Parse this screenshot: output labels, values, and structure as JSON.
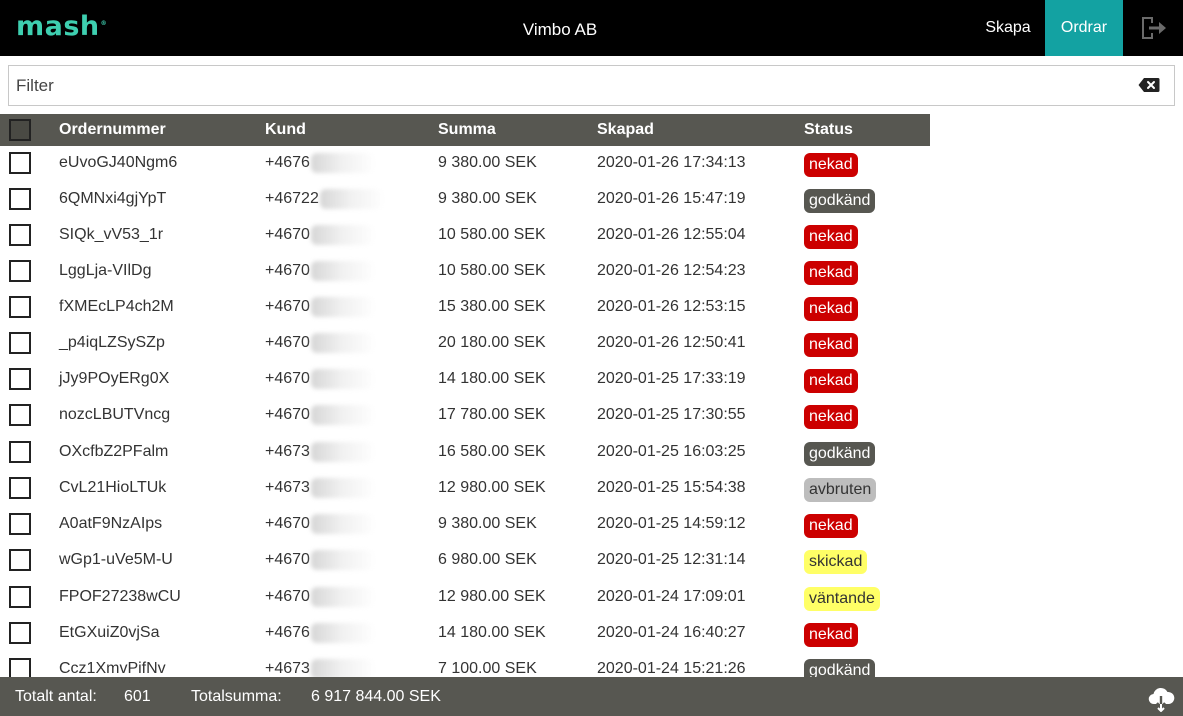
{
  "header": {
    "logo": "mash",
    "logo_mark": "®",
    "company": "Vimbo AB",
    "nav_create": "Skapa",
    "nav_orders": "Ordrar",
    "active_color": "#13a2a2"
  },
  "filter": {
    "placeholder": "Filter"
  },
  "table": {
    "columns": [
      "Ordernummer",
      "Kund",
      "Summa",
      "Skapad",
      "Status"
    ],
    "rows": [
      {
        "ordernummer": "eUvoGJ40Ngm6",
        "kund": "+4676",
        "summa": "9 380.00 SEK",
        "skapad": "2020-01-26 17:34:13",
        "status": "nekad"
      },
      {
        "ordernummer": "6QMNxi4gjYpT",
        "kund": "+46722",
        "summa": "9 380.00 SEK",
        "skapad": "2020-01-26 15:47:19",
        "status": "godkänd"
      },
      {
        "ordernummer": "SIQk_vV53_1r",
        "kund": "+4670",
        "summa": "10 580.00 SEK",
        "skapad": "2020-01-26 12:55:04",
        "status": "nekad"
      },
      {
        "ordernummer": "LggLja-VIlDg",
        "kund": "+4670",
        "summa": "10 580.00 SEK",
        "skapad": "2020-01-26 12:54:23",
        "status": "nekad"
      },
      {
        "ordernummer": "fXMEcLP4ch2M",
        "kund": "+4670",
        "summa": "15 380.00 SEK",
        "skapad": "2020-01-26 12:53:15",
        "status": "nekad"
      },
      {
        "ordernummer": "_p4iqLZSySZp",
        "kund": "+4670",
        "summa": "20 180.00 SEK",
        "skapad": "2020-01-26 12:50:41",
        "status": "nekad"
      },
      {
        "ordernummer": "jJy9POyERg0X",
        "kund": "+4670",
        "summa": "14 180.00 SEK",
        "skapad": "2020-01-25 17:33:19",
        "status": "nekad"
      },
      {
        "ordernummer": "nozcLBUTVncg",
        "kund": "+4670",
        "summa": "17 780.00 SEK",
        "skapad": "2020-01-25 17:30:55",
        "status": "nekad"
      },
      {
        "ordernummer": "OXcfbZ2PFalm",
        "kund": "+4673",
        "summa": "16 580.00 SEK",
        "skapad": "2020-01-25 16:03:25",
        "status": "godkänd"
      },
      {
        "ordernummer": "CvL21HioLTUk",
        "kund": "+4673",
        "summa": "12 980.00 SEK",
        "skapad": "2020-01-25 15:54:38",
        "status": "avbruten"
      },
      {
        "ordernummer": "A0atF9NzAIps",
        "kund": "+4670",
        "summa": "9 380.00 SEK",
        "skapad": "2020-01-25 14:59:12",
        "status": "nekad"
      },
      {
        "ordernummer": "wGp1-uVe5M-U",
        "kund": "+4670",
        "summa": "6 980.00 SEK",
        "skapad": "2020-01-25 12:31:14",
        "status": "skickad"
      },
      {
        "ordernummer": "FPOF27238wCU",
        "kund": "+4670",
        "summa": "12 980.00 SEK",
        "skapad": "2020-01-24 17:09:01",
        "status": "väntande"
      },
      {
        "ordernummer": "EtGXuiZ0vjSa",
        "kund": "+4676",
        "summa": "14 180.00 SEK",
        "skapad": "2020-01-24 16:40:27",
        "status": "nekad"
      },
      {
        "ordernummer": "Ccz1XmvPifNv",
        "kund": "+4673",
        "summa": "7 100.00 SEK",
        "skapad": "2020-01-24 15:21:26",
        "status": "godkänd"
      }
    ]
  },
  "footer": {
    "total_count_label": "Totalt antal:",
    "total_count": "601",
    "total_sum_label": "Totalsumma:",
    "total_sum": "6 917 844.00 SEK"
  },
  "status_colors": {
    "nekad": "#cc0000",
    "godkänd": "#575751",
    "avbruten": "#bdbdbd",
    "skickad": "#ffff66",
    "väntande": "#ffff66"
  }
}
